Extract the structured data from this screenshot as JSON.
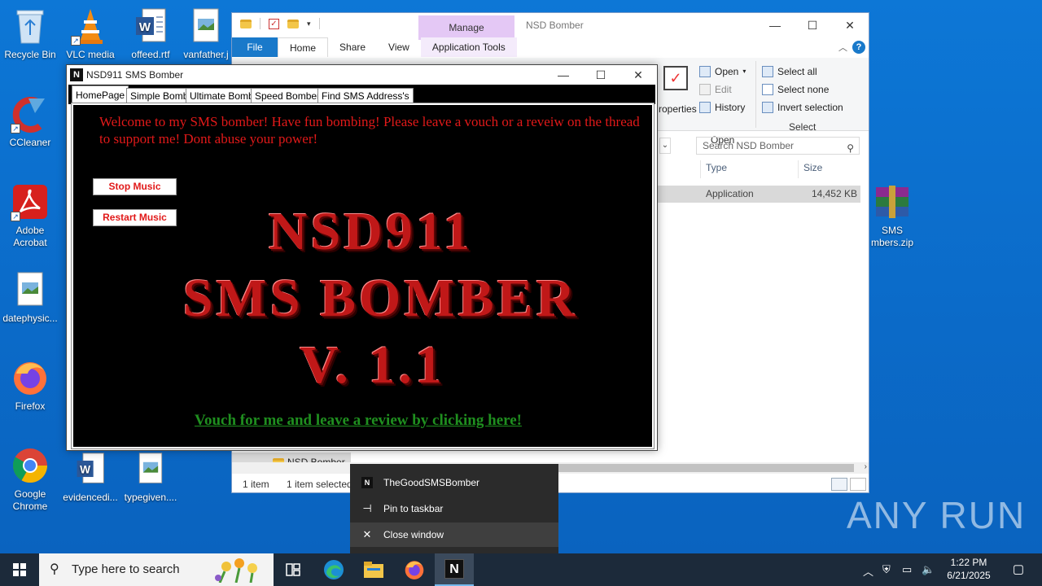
{
  "desktop": {
    "icons": [
      {
        "label": "Recycle Bin"
      },
      {
        "label": "VLC media"
      },
      {
        "label": "offeed.rtf"
      },
      {
        "label": "vanfather.j"
      },
      {
        "label": "CCleaner"
      },
      {
        "label": "Adobe Acrobat"
      },
      {
        "label": "datephysic..."
      },
      {
        "label": "Firefox"
      },
      {
        "label": "Google Chrome"
      },
      {
        "label": "evidencedi..."
      },
      {
        "label": "typegiven...."
      },
      {
        "label": "SMS mbers.zip"
      }
    ]
  },
  "explorer": {
    "title": "NSD Bomber",
    "manage_label": "Manage",
    "tabs": [
      "File",
      "Home",
      "Share",
      "View",
      "Application Tools"
    ],
    "ribbon": {
      "properties_label": "roperties",
      "open_group": {
        "items": [
          "Open",
          "Edit",
          "History"
        ],
        "label": "Open"
      },
      "select_group": {
        "items": [
          "Select all",
          "Select none",
          "Invert selection"
        ],
        "label": "Select"
      }
    },
    "search_placeholder": "Search NSD Bomber",
    "columns": [
      "Type",
      "Size"
    ],
    "row": {
      "type": "Application",
      "size": "14,452 KB"
    },
    "nav_item": "NSD Bomber",
    "status": {
      "items": "1 item",
      "selected": "1 item selected"
    }
  },
  "bomber": {
    "title": "NSD911 SMS Bomber",
    "tabs": [
      "HomePage",
      "Simple Bomb",
      "Ultimate Bomb",
      "Speed Bomber",
      "Find SMS Address's"
    ],
    "welcome": "Welcome to my SMS bomber! Have fun bombing! Please leave a vouch or a reveiw on the thread to support me! Dont abuse your power!",
    "stop_music": "Stop Music",
    "restart_music": "Restart Music",
    "banner": [
      "NSD911",
      "SMS BOMBER",
      "V. 1.1"
    ],
    "vouch_link": "Vouch for me and leave a review by clicking here!",
    "colors": {
      "red": "#e11919",
      "green": "#1f8f1f"
    }
  },
  "jumplist": {
    "app_name": "TheGoodSMSBomber",
    "pin": "Pin to taskbar",
    "close": "Close window"
  },
  "taskbar": {
    "search_placeholder": "Type here to search",
    "time": "1:22 PM",
    "date": "6/21/2025"
  },
  "watermark": "ANY RUN"
}
